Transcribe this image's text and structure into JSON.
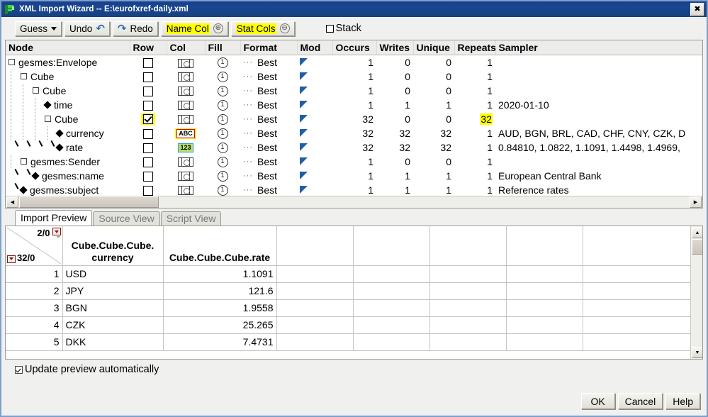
{
  "window": {
    "title": "XML Import Wizard -- E:\\eurofxref-daily.xml",
    "icon": "xml-import-icon",
    "close_label": "✖"
  },
  "toolbar": {
    "guess_label": "Guess",
    "undo_label": "Undo",
    "redo_label": "Redo",
    "name_col_label": "Name Col",
    "stat_cols_label": "Stat Cols",
    "name_col_badge": "⊕",
    "stat_cols_badge": "⊖",
    "stack_label": "Stack",
    "stack_checked": false
  },
  "tree": {
    "columns": [
      "Node",
      "Row",
      "Col",
      "Fill",
      "Format",
      "Mod",
      "Occurs",
      "Writes",
      "Unique",
      "Repeats",
      "Sampler"
    ],
    "rows": [
      {
        "label": "gesmes:Envelope",
        "depth": 0,
        "kind": "expander",
        "row_checked": false,
        "row_highlight": false,
        "col_icon": "grid-icon",
        "col_highlight": false,
        "fill": "①",
        "format": "Best",
        "occurs": "1",
        "writes": "0",
        "unique": "0",
        "repeats": "1",
        "repeats_highlight": false,
        "sampler": ""
      },
      {
        "label": "Cube",
        "depth": 1,
        "kind": "expander",
        "row_checked": false,
        "row_highlight": false,
        "col_icon": "grid-icon",
        "col_highlight": false,
        "fill": "①",
        "format": "Best",
        "occurs": "1",
        "writes": "0",
        "unique": "0",
        "repeats": "1",
        "repeats_highlight": false,
        "sampler": ""
      },
      {
        "label": "Cube",
        "depth": 2,
        "kind": "expander",
        "row_checked": false,
        "row_highlight": false,
        "col_icon": "grid-icon",
        "col_highlight": false,
        "fill": "①",
        "format": "Best",
        "occurs": "1",
        "writes": "0",
        "unique": "0",
        "repeats": "1",
        "repeats_highlight": false,
        "sampler": ""
      },
      {
        "label": "time",
        "depth": 3,
        "kind": "leaf",
        "row_checked": false,
        "row_highlight": false,
        "col_icon": "grid-icon",
        "col_highlight": false,
        "fill": "①",
        "format": "Best",
        "occurs": "1",
        "writes": "1",
        "unique": "1",
        "repeats": "1",
        "repeats_highlight": false,
        "sampler": "2020-01-10"
      },
      {
        "label": "Cube",
        "depth": 3,
        "kind": "expander",
        "row_checked": true,
        "row_highlight": true,
        "col_icon": "grid-icon",
        "col_highlight": false,
        "fill": "①",
        "format": "Best",
        "occurs": "32",
        "writes": "0",
        "unique": "0",
        "repeats": "32",
        "repeats_highlight": true,
        "sampler": ""
      },
      {
        "label": "currency",
        "depth": 4,
        "kind": "leaf",
        "row_checked": false,
        "row_highlight": false,
        "col_icon": "abc-icon",
        "col_highlight": true,
        "fill": "①",
        "format": "Best",
        "occurs": "32",
        "writes": "32",
        "unique": "32",
        "repeats": "1",
        "repeats_highlight": false,
        "sampler": "AUD, BGN, BRL, CAD, CHF, CNY, CZK, D"
      },
      {
        "label": "rate",
        "depth": 4,
        "kind": "leaf-last",
        "row_checked": false,
        "row_highlight": false,
        "col_icon": "123-icon",
        "col_highlight": false,
        "fill": "①",
        "format": "Best",
        "occurs": "32",
        "writes": "32",
        "unique": "32",
        "repeats": "1",
        "repeats_highlight": false,
        "sampler": "0.84810, 1.0822, 1.1091, 1.4498, 1.4969,"
      },
      {
        "label": "gesmes:Sender",
        "depth": 1,
        "kind": "expander",
        "row_checked": false,
        "row_highlight": false,
        "col_icon": "grid-icon",
        "col_highlight": false,
        "fill": "①",
        "format": "Best",
        "occurs": "1",
        "writes": "0",
        "unique": "0",
        "repeats": "1",
        "repeats_highlight": false,
        "sampler": ""
      },
      {
        "label": "gesmes:name",
        "depth": 2,
        "kind": "leaf-last",
        "row_checked": false,
        "row_highlight": false,
        "col_icon": "grid-icon",
        "col_highlight": false,
        "fill": "①",
        "format": "Best",
        "occurs": "1",
        "writes": "1",
        "unique": "1",
        "repeats": "1",
        "repeats_highlight": false,
        "sampler": "European Central Bank"
      },
      {
        "label": "gesmes:subject",
        "depth": 1,
        "kind": "leaf-last-root",
        "row_checked": false,
        "row_highlight": false,
        "col_icon": "grid-icon",
        "col_highlight": false,
        "fill": "①",
        "format": "Best",
        "occurs": "1",
        "writes": "1",
        "unique": "1",
        "repeats": "1",
        "repeats_highlight": false,
        "sampler": "Reference rates"
      }
    ]
  },
  "tabs": [
    {
      "label": "Import Preview",
      "active": true
    },
    {
      "label": "Source View",
      "active": false
    },
    {
      "label": "Script View",
      "active": false
    }
  ],
  "preview": {
    "corner_top": "2/0",
    "corner_bottom": "32/0",
    "columns": [
      "Cube.Cube.Cube. currency",
      "Cube.Cube.Cube.rate",
      "",
      "",
      "",
      ""
    ],
    "col1_line1": "Cube.Cube.Cube.",
    "col1_line2": "currency",
    "col2_line1": "Cube.Cube.Cube.rate",
    "rows": [
      {
        "n": "1",
        "currency": "USD",
        "rate": "1.1091"
      },
      {
        "n": "2",
        "currency": "JPY",
        "rate": "121.6"
      },
      {
        "n": "3",
        "currency": "BGN",
        "rate": "1.9558"
      },
      {
        "n": "4",
        "currency": "CZK",
        "rate": "25.265"
      },
      {
        "n": "5",
        "currency": "DKK",
        "rate": "7.4731"
      }
    ]
  },
  "footer": {
    "update_preview_label": "Update preview automatically",
    "update_preview_checked": true,
    "ok_label": "OK",
    "cancel_label": "Cancel",
    "help_label": "Help"
  },
  "colors": {
    "title_bar": "#17428a",
    "highlight_yellow": "#ffff00",
    "mod_triangle": "#1f5fa8",
    "window_border": "#7ba0cf"
  }
}
